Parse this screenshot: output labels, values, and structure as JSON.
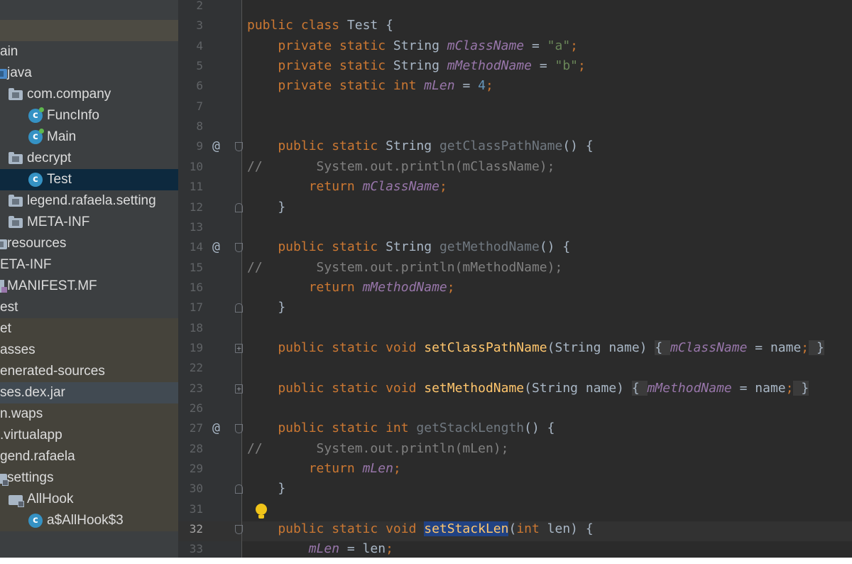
{
  "tree": {
    "items": [
      {
        "label": "",
        "icon": "none",
        "style": "band-light",
        "indent": 0
      },
      {
        "label": "ain",
        "icon": "none",
        "style": "",
        "indent": 0
      },
      {
        "label": "java",
        "icon": "blue-folder-icon",
        "style": "",
        "indent": 0
      },
      {
        "label": "com.company",
        "icon": "package-icon",
        "style": "",
        "indent": 1
      },
      {
        "label": "FuncInfo",
        "icon": "runnable-class-icon",
        "style": "",
        "indent": 2
      },
      {
        "label": "Main",
        "icon": "runnable-class-icon",
        "style": "",
        "indent": 2
      },
      {
        "label": "decrypt",
        "icon": "package-icon",
        "style": "",
        "indent": 1
      },
      {
        "label": "Test",
        "icon": "class-icon",
        "style": "selected",
        "indent": 2
      },
      {
        "label": "legend.rafaela.setting",
        "icon": "package-icon",
        "style": "",
        "indent": 1
      },
      {
        "label": "META-INF",
        "icon": "package-icon",
        "style": "",
        "indent": 1
      },
      {
        "label": "resources",
        "icon": "resources-folder-icon",
        "style": "",
        "indent": 0
      },
      {
        "label": "ETA-INF",
        "icon": "none",
        "style": "",
        "indent": 0
      },
      {
        "label": "MANIFEST.MF",
        "icon": "manifest-file-icon",
        "style": "",
        "indent": 0
      },
      {
        "label": "est",
        "icon": "none",
        "style": "",
        "indent": 0
      },
      {
        "label": "et",
        "icon": "none",
        "style": "band",
        "indent": 0
      },
      {
        "label": "asses",
        "icon": "none",
        "style": "band",
        "indent": 0
      },
      {
        "label": "enerated-sources",
        "icon": "none",
        "style": "band",
        "indent": 0
      },
      {
        "label": "ses.dex.jar",
        "icon": "none",
        "style": "hl-blue",
        "indent": 0
      },
      {
        "label": "n.waps",
        "icon": "none",
        "style": "band",
        "indent": 0
      },
      {
        "label": ".virtualapp",
        "icon": "none",
        "style": "band",
        "indent": 0
      },
      {
        "label": "gend.rafaela",
        "icon": "none",
        "style": "band",
        "indent": 0
      },
      {
        "label": "settings",
        "icon": "locked-package-icon",
        "style": "band",
        "indent": 0
      },
      {
        "label": "AllHook",
        "icon": "locked-package-icon",
        "style": "band",
        "indent": 1
      },
      {
        "label": "a$AllHook$3",
        "icon": "locked-class-icon",
        "style": "band",
        "indent": 2
      }
    ]
  },
  "editor": {
    "current_line": "32",
    "lines": [
      {
        "n": "2",
        "ann": "",
        "fold": "",
        "tokens": []
      },
      {
        "n": "3",
        "ann": "",
        "fold": "",
        "tokens": [
          [
            "kw",
            "public class "
          ],
          [
            "",
            "Test {"
          ]
        ]
      },
      {
        "n": "4",
        "ann": "",
        "fold": "",
        "tokens": [
          [
            "kw",
            "    private static "
          ],
          [
            "",
            "String "
          ],
          [
            "fld",
            "mClassName"
          ],
          [
            "",
            " = "
          ],
          [
            "str",
            "\"a\""
          ],
          [
            "kw",
            ";"
          ]
        ]
      },
      {
        "n": "5",
        "ann": "",
        "fold": "",
        "tokens": [
          [
            "kw",
            "    private static "
          ],
          [
            "",
            "String "
          ],
          [
            "fld",
            "mMethodName"
          ],
          [
            "",
            " = "
          ],
          [
            "str",
            "\"b\""
          ],
          [
            "kw",
            ";"
          ]
        ]
      },
      {
        "n": "6",
        "ann": "",
        "fold": "",
        "tokens": [
          [
            "kw",
            "    private static int "
          ],
          [
            "fld",
            "mLen"
          ],
          [
            "",
            " = "
          ],
          [
            "num",
            "4"
          ],
          [
            "kw",
            ";"
          ]
        ]
      },
      {
        "n": "7",
        "ann": "",
        "fold": "",
        "tokens": []
      },
      {
        "n": "8",
        "ann": "",
        "fold": "",
        "tokens": []
      },
      {
        "n": "9",
        "ann": "@",
        "fold": "down",
        "tokens": [
          [
            "kw",
            "    public static "
          ],
          [
            "",
            "String "
          ],
          [
            "dim",
            "getClassPathName"
          ],
          [
            "",
            "() {"
          ]
        ]
      },
      {
        "n": "10",
        "ann": "",
        "fold": "",
        "tokens": [
          [
            "cmt",
            "//       System.out.println(mClassName);"
          ]
        ]
      },
      {
        "n": "11",
        "ann": "",
        "fold": "",
        "tokens": [
          [
            "kw",
            "        return "
          ],
          [
            "fld",
            "mClassName"
          ],
          [
            "kw",
            ";"
          ]
        ]
      },
      {
        "n": "12",
        "ann": "",
        "fold": "up",
        "tokens": [
          [
            "",
            "    }"
          ]
        ]
      },
      {
        "n": "13",
        "ann": "",
        "fold": "",
        "tokens": []
      },
      {
        "n": "14",
        "ann": "@",
        "fold": "down",
        "tokens": [
          [
            "kw",
            "    public static "
          ],
          [
            "",
            "String "
          ],
          [
            "dim",
            "getMethodName"
          ],
          [
            "",
            "() {"
          ]
        ]
      },
      {
        "n": "15",
        "ann": "",
        "fold": "",
        "tokens": [
          [
            "cmt",
            "//       System.out.println(mMethodName);"
          ]
        ]
      },
      {
        "n": "16",
        "ann": "",
        "fold": "",
        "tokens": [
          [
            "kw",
            "        return "
          ],
          [
            "fld",
            "mMethodName"
          ],
          [
            "kw",
            ";"
          ]
        ]
      },
      {
        "n": "17",
        "ann": "",
        "fold": "up",
        "tokens": [
          [
            "",
            "    }"
          ]
        ]
      },
      {
        "n": "18",
        "ann": "",
        "fold": "",
        "tokens": []
      },
      {
        "n": "19",
        "ann": "",
        "fold": "plus",
        "tokens": [
          [
            "kw",
            "    public static void "
          ],
          [
            "fn",
            "setClassPathName"
          ],
          [
            "",
            "(String name)"
          ],
          [
            "",
            " "
          ],
          [
            "fold-blk",
            "{ "
          ],
          [
            "fld",
            "mClassName"
          ],
          [
            "",
            " = name"
          ],
          [
            "kw",
            ";"
          ],
          [
            "fold-blk",
            " }"
          ]
        ]
      },
      {
        "n": "22",
        "ann": "",
        "fold": "",
        "tokens": []
      },
      {
        "n": "23",
        "ann": "",
        "fold": "plus",
        "tokens": [
          [
            "kw",
            "    public static void "
          ],
          [
            "fn",
            "setMethodName"
          ],
          [
            "",
            "(String name)"
          ],
          [
            "",
            " "
          ],
          [
            "fold-blk",
            "{ "
          ],
          [
            "fld",
            "mMethodName"
          ],
          [
            "",
            " = name"
          ],
          [
            "kw",
            ";"
          ],
          [
            "fold-blk",
            " }"
          ]
        ]
      },
      {
        "n": "26",
        "ann": "",
        "fold": "",
        "tokens": []
      },
      {
        "n": "27",
        "ann": "@",
        "fold": "down",
        "tokens": [
          [
            "kw",
            "    public static int "
          ],
          [
            "dim",
            "getStackLength"
          ],
          [
            "",
            "() {"
          ]
        ]
      },
      {
        "n": "28",
        "ann": "",
        "fold": "",
        "tokens": [
          [
            "cmt",
            "//       System.out.println(mLen);"
          ]
        ]
      },
      {
        "n": "29",
        "ann": "",
        "fold": "",
        "tokens": [
          [
            "kw",
            "        return "
          ],
          [
            "fld",
            "mLen"
          ],
          [
            "kw",
            ";"
          ]
        ]
      },
      {
        "n": "30",
        "ann": "",
        "fold": "up",
        "tokens": [
          [
            "",
            "    }"
          ]
        ]
      },
      {
        "n": "31",
        "ann": "",
        "fold": "",
        "tokens": []
      },
      {
        "n": "32",
        "ann": "",
        "fold": "down",
        "tokens": [
          [
            "kw",
            "    public static void "
          ],
          [
            "sel-word fn",
            "setStackLen"
          ],
          [
            "",
            "("
          ],
          [
            "kw",
            "int "
          ],
          [
            "",
            "len) {"
          ]
        ]
      },
      {
        "n": "33",
        "ann": "",
        "fold": "",
        "tokens": [
          [
            "fld",
            "        mLen"
          ],
          [
            "",
            " = len"
          ],
          [
            "kw",
            ";"
          ]
        ]
      }
    ]
  },
  "colors": {
    "keyword": "#cc7832",
    "string": "#6a8759",
    "number": "#6897bb",
    "field": "#9876aa",
    "comment": "#808080",
    "method": "#ffc66d",
    "selection": "#0d293e"
  }
}
